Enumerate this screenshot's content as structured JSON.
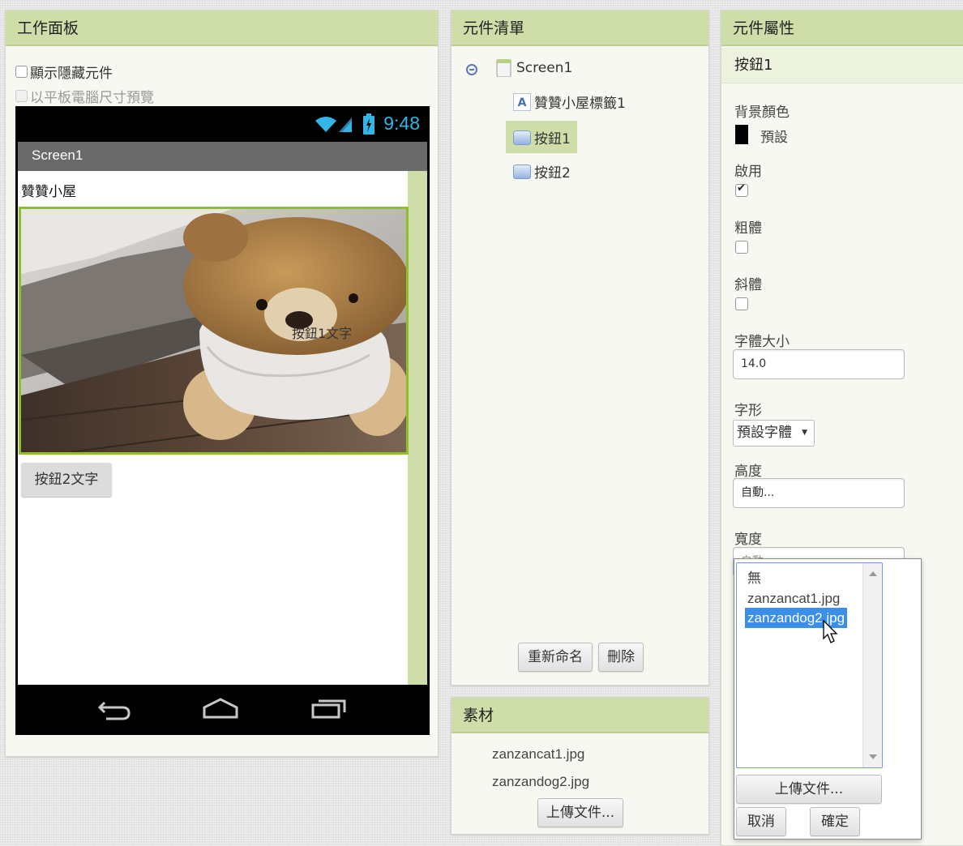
{
  "viewer": {
    "title": "工作面板",
    "show_hidden_label": "顯示隱藏元件",
    "tablet_preview_label": "以平板電腦尺寸預覽",
    "clock": "9:48",
    "screen_title": "Screen1",
    "label_text": "贊贊小屋",
    "button1_text": "按鈕1文字",
    "button2_text": "按鈕2文字"
  },
  "components": {
    "title": "元件清單",
    "tree": {
      "root": "Screen1",
      "children": [
        "贊贊小屋標籤1",
        "按鈕1",
        "按鈕2"
      ]
    },
    "selected": "按鈕1",
    "rename_label": "重新命名",
    "delete_label": "刪除"
  },
  "media": {
    "title": "素材",
    "files": [
      "zanzancat1.jpg",
      "zanzandog2.jpg"
    ],
    "upload_label": "上傳文件..."
  },
  "properties": {
    "title": "元件屬性",
    "component_name": "按鈕1",
    "bg_color_label": "背景顏色",
    "bg_color_value": "預設",
    "bg_color_hex": "#000000",
    "enabled_label": "啟用",
    "enabled": true,
    "bold_label": "粗體",
    "bold": false,
    "italic_label": "斜體",
    "italic": false,
    "font_size_label": "字體大小",
    "font_size_value": "14.0",
    "typeface_label": "字形",
    "typeface_value": "預設字體",
    "height_label": "高度",
    "height_value": "自動...",
    "width_label": "寬度",
    "width_value": "自動..."
  },
  "image_picker": {
    "options": [
      "無",
      "zanzancat1.jpg",
      "zanzandog2.jpg"
    ],
    "selected": "zanzandog2.jpg",
    "upload_label": "上傳文件...",
    "cancel_label": "取消",
    "ok_label": "確定"
  },
  "colors": {
    "header_bg": "#cfdea8",
    "selection_bg": "#cfdea8",
    "list_selected": "#3b8fe8",
    "clock": "#33b5e5"
  }
}
